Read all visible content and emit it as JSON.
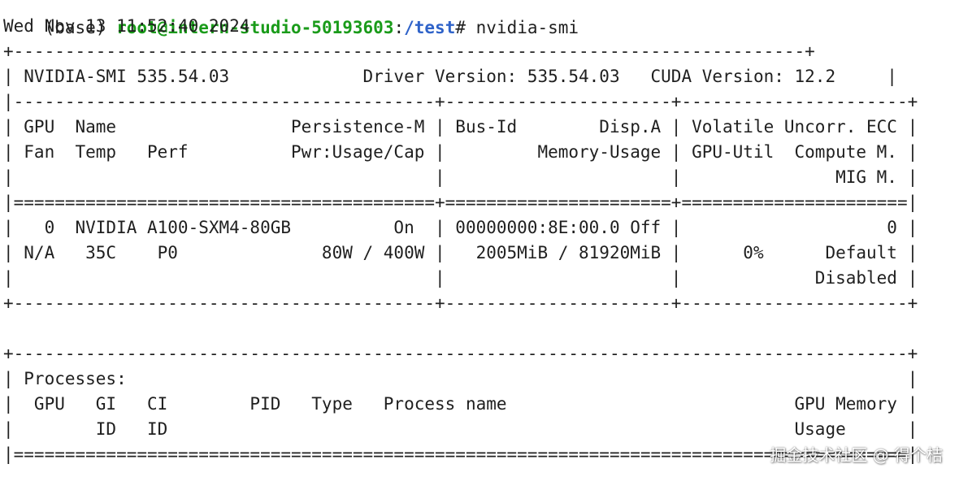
{
  "prompt": {
    "env": "(base) ",
    "user_host": "root@intern-studio-50193603",
    "sep": ":",
    "path": "/test",
    "symbol": "# ",
    "command": "nvidia-smi"
  },
  "timestamp": "Wed Nov 13 11:52:40 2024",
  "smi_table": [
    "+-----------------------------------------------------------------------------+",
    "| NVIDIA-SMI 535.54.03             Driver Version: 535.54.03   CUDA Version: 12.2     |",
    "|-----------------------------------------+----------------------+----------------------+",
    "| GPU  Name                 Persistence-M | Bus-Id        Disp.A | Volatile Uncorr. ECC |",
    "| Fan  Temp   Perf          Pwr:Usage/Cap |         Memory-Usage | GPU-Util  Compute M. |",
    "|                                         |                      |               MIG M. |",
    "|=========================================+======================+======================|",
    "|   0  NVIDIA A100-SXM4-80GB          On  | 00000000:8E:00.0 Off |                    0 |",
    "| N/A   35C    P0              80W / 400W |   2005MiB / 81920MiB |      0%      Default |",
    "|                                         |                      |             Disabled |",
    "+-----------------------------------------+----------------------+----------------------+"
  ],
  "proc_table": [
    "+---------------------------------------------------------------------------------------+",
    "| Processes:                                                                            |",
    "|  GPU   GI   CI        PID   Type   Process name                            GPU Memory |",
    "|        ID   ID                                                             Usage      |",
    "|=======================================================================================|"
  ],
  "watermark": "掘金技术社区 @ 得个桔"
}
